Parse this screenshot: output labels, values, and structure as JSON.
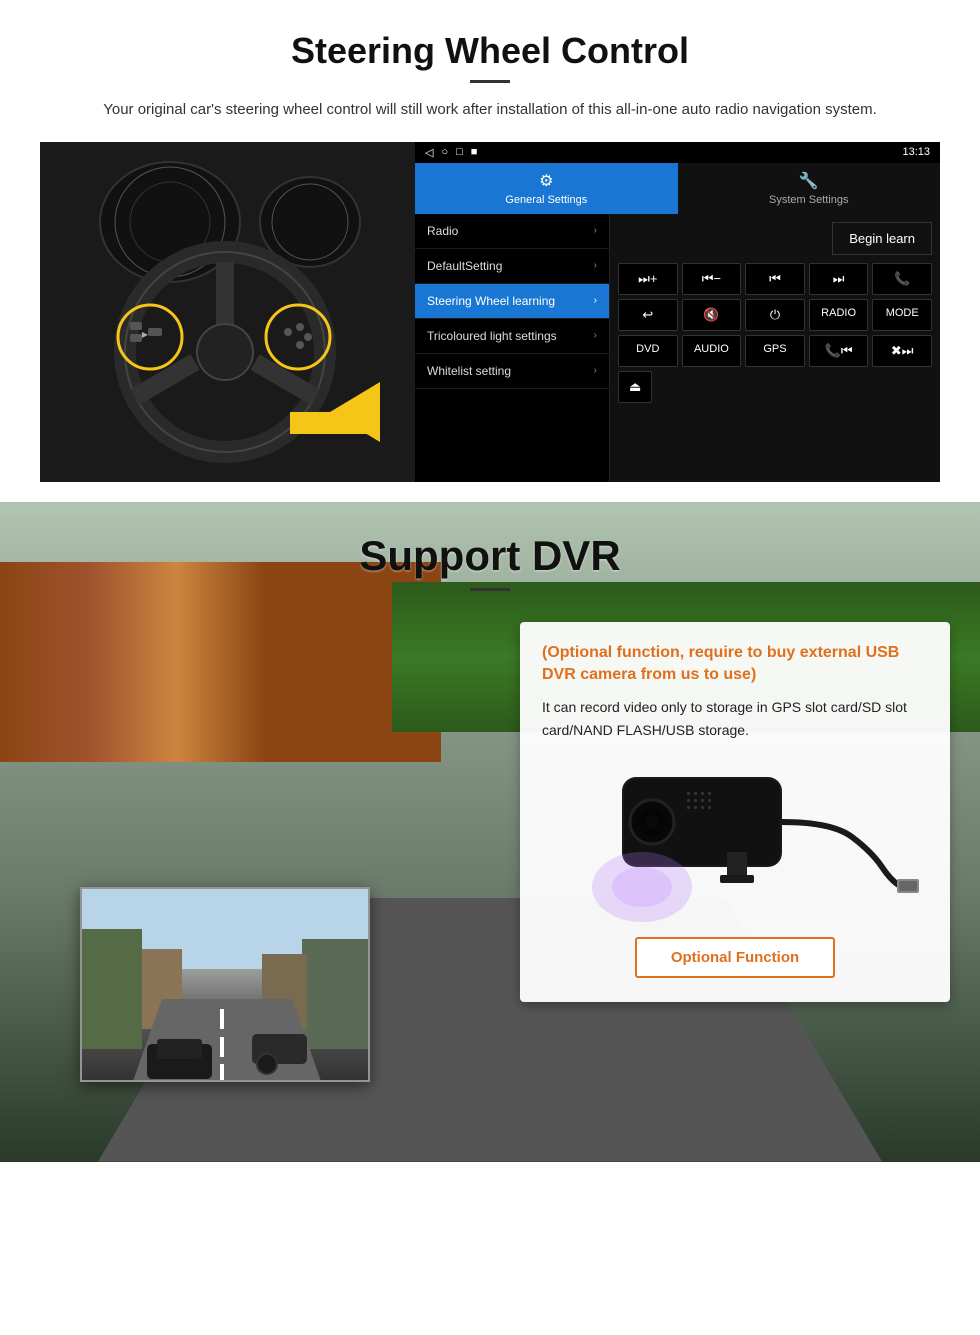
{
  "page": {
    "section1": {
      "title": "Steering Wheel Control",
      "subtitle": "Your original car's steering wheel control will still work after installation of this all-in-one auto radio navigation system.",
      "android": {
        "statusbar": {
          "time": "13:13",
          "icons_left": [
            "◁",
            "○",
            "□",
            "■"
          ],
          "signal": "▼"
        },
        "tabs": [
          {
            "label": "General Settings",
            "icon": "⚙",
            "active": true
          },
          {
            "label": "System Settings",
            "icon": "🔧",
            "active": false
          }
        ],
        "menu_items": [
          {
            "label": "Radio",
            "active": false
          },
          {
            "label": "DefaultSetting",
            "active": false
          },
          {
            "label": "Steering Wheel learning",
            "active": true
          },
          {
            "label": "Tricoloured light settings",
            "active": false
          },
          {
            "label": "Whitelist setting",
            "active": false
          }
        ],
        "begin_learn": "Begin learn",
        "control_rows": [
          [
            "⏭+",
            "⏮-",
            "⏮⏮",
            "⏭⏭",
            "📞"
          ],
          [
            "☎↩",
            "🔇×",
            "⏻",
            "RADIO",
            "MODE"
          ],
          [
            "DVD",
            "AUDIO",
            "GPS",
            "📞⏮",
            "✖⏭"
          ]
        ],
        "last_icon": "⏏"
      }
    },
    "section2": {
      "title": "Support DVR",
      "card": {
        "title": "(Optional function, require to buy external USB DVR camera from us to use)",
        "text": "It can record video only to storage in GPS slot card/SD slot card/NAND FLASH/USB storage.",
        "optional_button": "Optional Function"
      }
    }
  }
}
